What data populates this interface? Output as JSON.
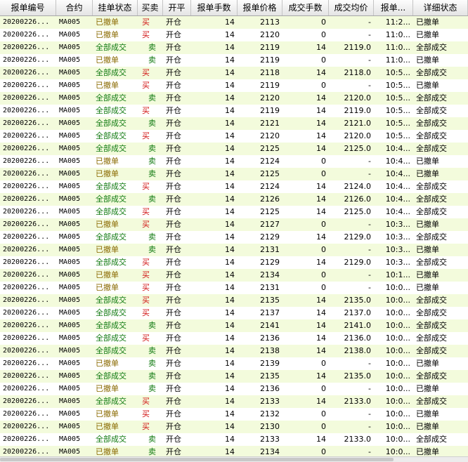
{
  "columns": [
    "报单编号",
    "合约",
    "挂单状态",
    "买卖",
    "开平",
    "报单手数",
    "报单价格",
    "成交手数",
    "成交均价",
    "报单...",
    "详细状态"
  ],
  "colors": {
    "buy": "#d01010",
    "sell": "#107a10",
    "filled": "#107a10",
    "canceled": "#8a6a00",
    "row_alt": "#f3fbdc"
  },
  "rows": [
    {
      "id": "20200226...",
      "contract": "MA005",
      "status": "已撤单",
      "side": "买",
      "oc": "开仓",
      "qty": "14",
      "price": "2113",
      "filled_qty": "0",
      "avg": "-",
      "time": "11:2...",
      "detail": "已撤单"
    },
    {
      "id": "20200226...",
      "contract": "MA005",
      "status": "已撤单",
      "side": "买",
      "oc": "开仓",
      "qty": "14",
      "price": "2120",
      "filled_qty": "0",
      "avg": "-",
      "time": "11:0...",
      "detail": "已撤单"
    },
    {
      "id": "20200226...",
      "contract": "MA005",
      "status": "全部成交",
      "side": "卖",
      "oc": "开仓",
      "qty": "14",
      "price": "2119",
      "filled_qty": "14",
      "avg": "2119.0",
      "time": "11:0...",
      "detail": "全部成交"
    },
    {
      "id": "20200226...",
      "contract": "MA005",
      "status": "已撤单",
      "side": "卖",
      "oc": "开仓",
      "qty": "14",
      "price": "2119",
      "filled_qty": "0",
      "avg": "-",
      "time": "11:0...",
      "detail": "已撤单"
    },
    {
      "id": "20200226...",
      "contract": "MA005",
      "status": "全部成交",
      "side": "买",
      "oc": "开仓",
      "qty": "14",
      "price": "2118",
      "filled_qty": "14",
      "avg": "2118.0",
      "time": "10:5...",
      "detail": "全部成交"
    },
    {
      "id": "20200226...",
      "contract": "MA005",
      "status": "已撤单",
      "side": "买",
      "oc": "开仓",
      "qty": "14",
      "price": "2119",
      "filled_qty": "0",
      "avg": "-",
      "time": "10:5...",
      "detail": "已撤单"
    },
    {
      "id": "20200226...",
      "contract": "MA005",
      "status": "全部成交",
      "side": "卖",
      "oc": "开仓",
      "qty": "14",
      "price": "2120",
      "filled_qty": "14",
      "avg": "2120.0",
      "time": "10:5...",
      "detail": "全部成交"
    },
    {
      "id": "20200226...",
      "contract": "MA005",
      "status": "全部成交",
      "side": "买",
      "oc": "开仓",
      "qty": "14",
      "price": "2119",
      "filled_qty": "14",
      "avg": "2119.0",
      "time": "10:5...",
      "detail": "全部成交"
    },
    {
      "id": "20200226...",
      "contract": "MA005",
      "status": "全部成交",
      "side": "卖",
      "oc": "开仓",
      "qty": "14",
      "price": "2121",
      "filled_qty": "14",
      "avg": "2121.0",
      "time": "10:5...",
      "detail": "全部成交"
    },
    {
      "id": "20200226...",
      "contract": "MA005",
      "status": "全部成交",
      "side": "买",
      "oc": "开仓",
      "qty": "14",
      "price": "2120",
      "filled_qty": "14",
      "avg": "2120.0",
      "time": "10:5...",
      "detail": "全部成交"
    },
    {
      "id": "20200226...",
      "contract": "MA005",
      "status": "全部成交",
      "side": "卖",
      "oc": "开仓",
      "qty": "14",
      "price": "2125",
      "filled_qty": "14",
      "avg": "2125.0",
      "time": "10:4...",
      "detail": "全部成交"
    },
    {
      "id": "20200226...",
      "contract": "MA005",
      "status": "已撤单",
      "side": "卖",
      "oc": "开仓",
      "qty": "14",
      "price": "2124",
      "filled_qty": "0",
      "avg": "-",
      "time": "10:4...",
      "detail": "已撤单"
    },
    {
      "id": "20200226...",
      "contract": "MA005",
      "status": "已撤单",
      "side": "卖",
      "oc": "开仓",
      "qty": "14",
      "price": "2125",
      "filled_qty": "0",
      "avg": "-",
      "time": "10:4...",
      "detail": "已撤单"
    },
    {
      "id": "20200226...",
      "contract": "MA005",
      "status": "全部成交",
      "side": "买",
      "oc": "开仓",
      "qty": "14",
      "price": "2124",
      "filled_qty": "14",
      "avg": "2124.0",
      "time": "10:4...",
      "detail": "全部成交"
    },
    {
      "id": "20200226...",
      "contract": "MA005",
      "status": "全部成交",
      "side": "卖",
      "oc": "开仓",
      "qty": "14",
      "price": "2126",
      "filled_qty": "14",
      "avg": "2126.0",
      "time": "10:4...",
      "detail": "全部成交"
    },
    {
      "id": "20200226...",
      "contract": "MA005",
      "status": "全部成交",
      "side": "买",
      "oc": "开仓",
      "qty": "14",
      "price": "2125",
      "filled_qty": "14",
      "avg": "2125.0",
      "time": "10:4...",
      "detail": "全部成交"
    },
    {
      "id": "20200226...",
      "contract": "MA005",
      "status": "已撤单",
      "side": "买",
      "oc": "开仓",
      "qty": "14",
      "price": "2127",
      "filled_qty": "0",
      "avg": "-",
      "time": "10:3...",
      "detail": "已撤单"
    },
    {
      "id": "20200226...",
      "contract": "MA005",
      "status": "全部成交",
      "side": "卖",
      "oc": "开仓",
      "qty": "14",
      "price": "2129",
      "filled_qty": "14",
      "avg": "2129.0",
      "time": "10:3...",
      "detail": "全部成交"
    },
    {
      "id": "20200226...",
      "contract": "MA005",
      "status": "已撤单",
      "side": "卖",
      "oc": "开仓",
      "qty": "14",
      "price": "2131",
      "filled_qty": "0",
      "avg": "-",
      "time": "10:3...",
      "detail": "已撤单"
    },
    {
      "id": "20200226...",
      "contract": "MA005",
      "status": "全部成交",
      "side": "买",
      "oc": "开仓",
      "qty": "14",
      "price": "2129",
      "filled_qty": "14",
      "avg": "2129.0",
      "time": "10:3...",
      "detail": "全部成交"
    },
    {
      "id": "20200226...",
      "contract": "MA005",
      "status": "已撤单",
      "side": "买",
      "oc": "开仓",
      "qty": "14",
      "price": "2134",
      "filled_qty": "0",
      "avg": "-",
      "time": "10:1...",
      "detail": "已撤单"
    },
    {
      "id": "20200226...",
      "contract": "MA005",
      "status": "已撤单",
      "side": "买",
      "oc": "开仓",
      "qty": "14",
      "price": "2131",
      "filled_qty": "0",
      "avg": "-",
      "time": "10:0...",
      "detail": "已撤单"
    },
    {
      "id": "20200226...",
      "contract": "MA005",
      "status": "全部成交",
      "side": "买",
      "oc": "开仓",
      "qty": "14",
      "price": "2135",
      "filled_qty": "14",
      "avg": "2135.0",
      "time": "10:0...",
      "detail": "全部成交"
    },
    {
      "id": "20200226...",
      "contract": "MA005",
      "status": "全部成交",
      "side": "买",
      "oc": "开仓",
      "qty": "14",
      "price": "2137",
      "filled_qty": "14",
      "avg": "2137.0",
      "time": "10:0...",
      "detail": "全部成交"
    },
    {
      "id": "20200226...",
      "contract": "MA005",
      "status": "全部成交",
      "side": "卖",
      "oc": "开仓",
      "qty": "14",
      "price": "2141",
      "filled_qty": "14",
      "avg": "2141.0",
      "time": "10:0...",
      "detail": "全部成交"
    },
    {
      "id": "20200226...",
      "contract": "MA005",
      "status": "全部成交",
      "side": "买",
      "oc": "开仓",
      "qty": "14",
      "price": "2136",
      "filled_qty": "14",
      "avg": "2136.0",
      "time": "10:0...",
      "detail": "全部成交"
    },
    {
      "id": "20200226...",
      "contract": "MA005",
      "status": "全部成交",
      "side": "卖",
      "oc": "开仓",
      "qty": "14",
      "price": "2138",
      "filled_qty": "14",
      "avg": "2138.0",
      "time": "10:0...",
      "detail": "全部成交"
    },
    {
      "id": "20200226...",
      "contract": "MA005",
      "status": "已撤单",
      "side": "卖",
      "oc": "开仓",
      "qty": "14",
      "price": "2139",
      "filled_qty": "0",
      "avg": "-",
      "time": "10:0...",
      "detail": "已撤单"
    },
    {
      "id": "20200226...",
      "contract": "MA005",
      "status": "全部成交",
      "side": "卖",
      "oc": "开仓",
      "qty": "14",
      "price": "2135",
      "filled_qty": "14",
      "avg": "2135.0",
      "time": "10:0...",
      "detail": "全部成交"
    },
    {
      "id": "20200226...",
      "contract": "MA005",
      "status": "已撤单",
      "side": "卖",
      "oc": "开仓",
      "qty": "14",
      "price": "2136",
      "filled_qty": "0",
      "avg": "-",
      "time": "10:0...",
      "detail": "已撤单"
    },
    {
      "id": "20200226...",
      "contract": "MA005",
      "status": "全部成交",
      "side": "买",
      "oc": "开仓",
      "qty": "14",
      "price": "2133",
      "filled_qty": "14",
      "avg": "2133.0",
      "time": "10:0...",
      "detail": "全部成交"
    },
    {
      "id": "20200226...",
      "contract": "MA005",
      "status": "已撤单",
      "side": "买",
      "oc": "开仓",
      "qty": "14",
      "price": "2132",
      "filled_qty": "0",
      "avg": "-",
      "time": "10:0...",
      "detail": "已撤单"
    },
    {
      "id": "20200226...",
      "contract": "MA005",
      "status": "已撤单",
      "side": "买",
      "oc": "开仓",
      "qty": "14",
      "price": "2130",
      "filled_qty": "0",
      "avg": "-",
      "time": "10:0...",
      "detail": "已撤单"
    },
    {
      "id": "20200226...",
      "contract": "MA005",
      "status": "全部成交",
      "side": "卖",
      "oc": "开仓",
      "qty": "14",
      "price": "2133",
      "filled_qty": "14",
      "avg": "2133.0",
      "time": "10:0...",
      "detail": "全部成交"
    },
    {
      "id": "20200226...",
      "contract": "MA005",
      "status": "已撤单",
      "side": "卖",
      "oc": "开仓",
      "qty": "14",
      "price": "2134",
      "filled_qty": "0",
      "avg": "-",
      "time": "10:0...",
      "detail": "已撤单"
    }
  ]
}
